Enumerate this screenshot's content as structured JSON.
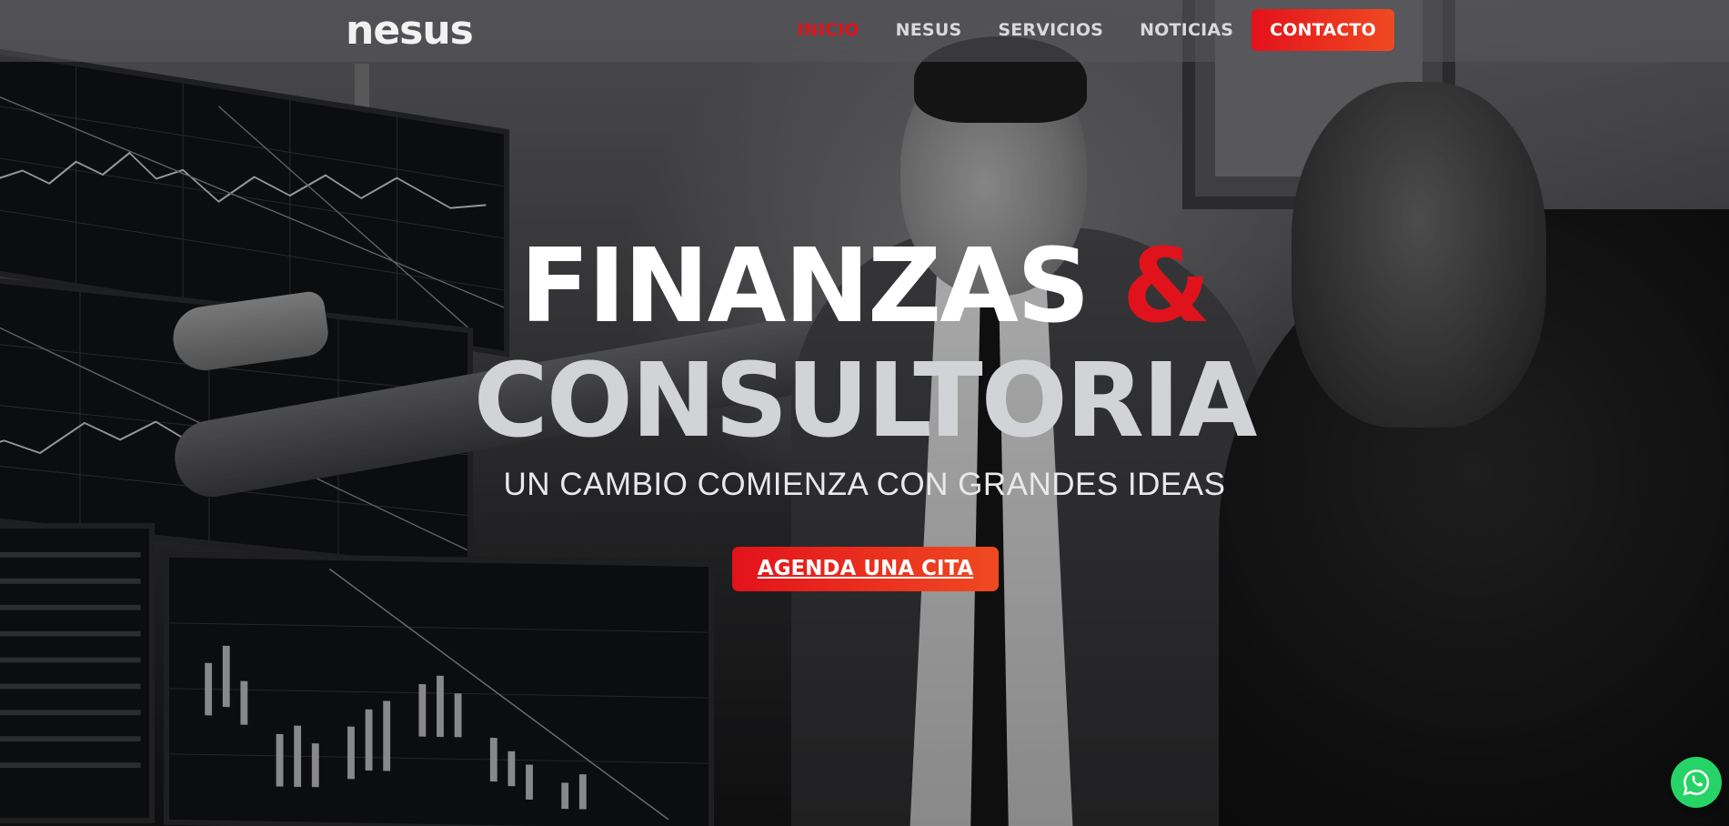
{
  "header": {
    "logo": "nesus",
    "nav": [
      {
        "label": "INICIO",
        "active": true
      },
      {
        "label": "NESUS",
        "active": false
      },
      {
        "label": "SERVICIOS",
        "active": false
      },
      {
        "label": "NOTICIAS",
        "active": false
      }
    ],
    "contact_label": "CONTACTO"
  },
  "hero": {
    "title_word1": "FINANZAS",
    "title_amp": "&",
    "title_word2": "CONSULTORIA",
    "subtitle": "UN CAMBIO COMIENZA CON GRANDES IDEAS",
    "cta_label": "AGENDA UNA CITA"
  },
  "icons": {
    "whatsapp": "whatsapp-icon"
  },
  "colors": {
    "accent": "#e0121b",
    "accent_gradient_end": "#ef4a21",
    "whatsapp": "#25d366"
  }
}
